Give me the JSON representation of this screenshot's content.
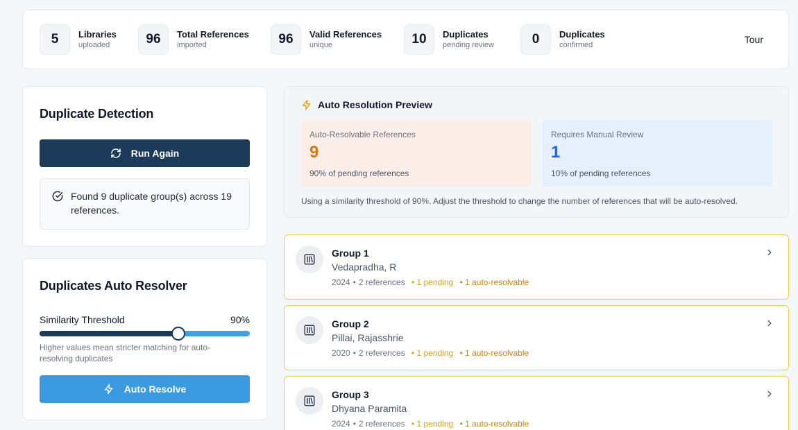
{
  "stats": [
    {
      "value": "5",
      "title": "Libraries",
      "sub": "uploaded"
    },
    {
      "value": "96",
      "title": "Total References",
      "sub": "imported"
    },
    {
      "value": "96",
      "title": "Valid References",
      "sub": "unique"
    },
    {
      "value": "10",
      "title": "Duplicates",
      "sub": "pending review"
    },
    {
      "value": "0",
      "title": "Duplicates",
      "sub": "confirmed"
    }
  ],
  "tour_label": "Tour",
  "detection": {
    "title": "Duplicate Detection",
    "run_again_label": "Run Again",
    "found_text": "Found 9 duplicate group(s) across 19 references."
  },
  "resolver": {
    "title": "Duplicates Auto Resolver",
    "threshold_label": "Similarity Threshold",
    "threshold_value": "90%",
    "threshold_fraction": 0.66,
    "help_text": "Higher values mean stricter matching for auto-resolving duplicates",
    "auto_resolve_label": "Auto Resolve"
  },
  "preview": {
    "title": "Auto Resolution Preview",
    "auto_box": {
      "label": "Auto-Resolvable References",
      "value": "9",
      "sub": "90% of pending references"
    },
    "manual_box": {
      "label": "Requires Manual Review",
      "value": "1",
      "sub": "10% of pending references"
    },
    "note": "Using a similarity threshold of 90%. Adjust the threshold to change the number of references that will be auto-resolved."
  },
  "groups": [
    {
      "title": "Group 1",
      "author": "Vedapradha, R",
      "year": "2024",
      "refs": "2 references",
      "pending": "1 pending",
      "auto": "1 auto-resolvable"
    },
    {
      "title": "Group 2",
      "author": "Pillai, Rajasshrie",
      "year": "2020",
      "refs": "2 references",
      "pending": "1 pending",
      "auto": "1 auto-resolvable"
    },
    {
      "title": "Group 3",
      "author": "Dhyana Paramita",
      "year": "2024",
      "refs": "2 references",
      "pending": "1 pending",
      "auto": "1 auto-resolvable"
    }
  ],
  "colors": {
    "primary_dark": "#1c3a5a",
    "primary_blue": "#3b9ae0",
    "auto_orange": "#d97706",
    "manual_blue": "#2563eb",
    "group_border": "#f3cc52"
  }
}
